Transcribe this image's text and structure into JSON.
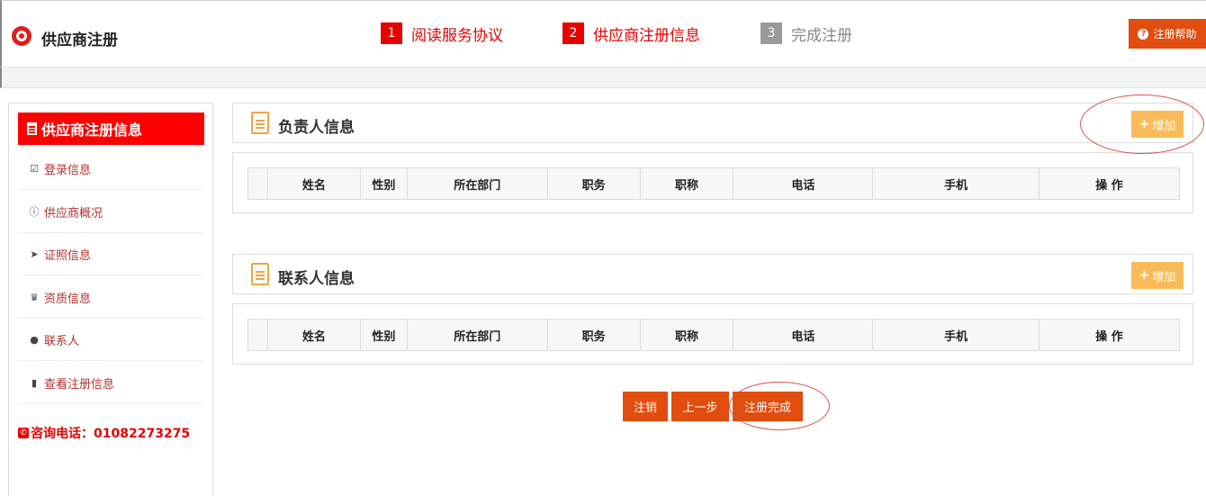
{
  "header": {
    "brand": "供应商注册",
    "steps": [
      {
        "num": "1",
        "label": "阅读服务协议"
      },
      {
        "num": "2",
        "label": "供应商注册信息"
      },
      {
        "num": "3",
        "label": "完成注册"
      }
    ],
    "help_label": "注册帮助"
  },
  "sidebar": {
    "title": "供应商注册信息",
    "items": [
      {
        "label": "登录信息",
        "icon": "check-square-icon"
      },
      {
        "label": "供应商概况",
        "icon": "info-circle-icon"
      },
      {
        "label": "证照信息",
        "icon": "paper-plane-icon"
      },
      {
        "label": "资质信息",
        "icon": "trophy-icon"
      },
      {
        "label": "联系人",
        "icon": "user-icon"
      },
      {
        "label": "查看注册信息",
        "icon": "bookmark-icon"
      }
    ],
    "phone_label": "咨询电话：01082273275"
  },
  "sections": [
    {
      "title": "负责人信息",
      "add_label": "增加"
    },
    {
      "title": "联系人信息",
      "add_label": "增加"
    }
  ],
  "table_headers": [
    "",
    "姓名",
    "性别",
    "所在部门",
    "职务",
    "职称",
    "电话",
    "手机",
    "操 作"
  ],
  "actions": {
    "cancel": "注销",
    "prev": "上一步",
    "finish": "注册完成"
  },
  "colors": {
    "accent_red": "#e60000",
    "button_orange": "#e14d0f",
    "add_yellow": "#f9bb59",
    "annotation_circle": "#e05050"
  }
}
